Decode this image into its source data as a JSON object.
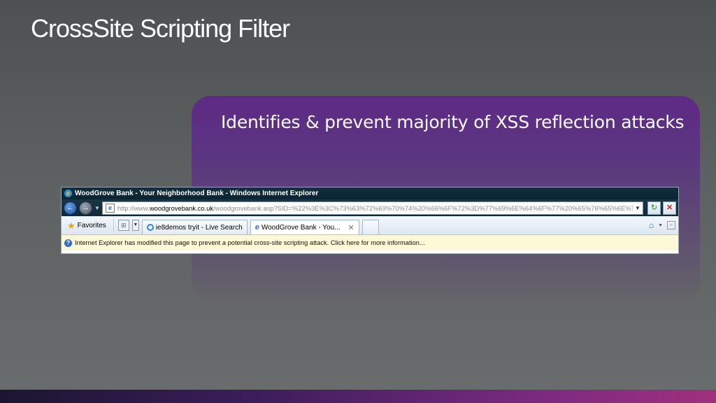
{
  "slide": {
    "title": "CrossSite Scripting Filter",
    "panel_text": "Identifies & prevent majority of XSS reflection attacks"
  },
  "browser": {
    "window_title": "WoodGrove Bank - Your Neighborhood Bank - Windows Internet Explorer",
    "address": {
      "prefix": "http://www.",
      "domain": "woodgrovebank.co.uk",
      "path": "/woodgrovebank.asp?SID=%22%3E%3C%73%63%72%69%70%74%20%66%6F%72%3D%77%69%6E%64%6F%77%20%65%76%65%6E%74%3"
    },
    "favorites_label": "Favorites",
    "tabs": [
      {
        "label": "ie8demos tryit - Live Search"
      },
      {
        "label": "WoodGrove Bank - You..."
      }
    ],
    "info_bar": "Internet Explorer has modified this page to prevent a potential cross-site scripting attack.  Click here for more information..."
  }
}
